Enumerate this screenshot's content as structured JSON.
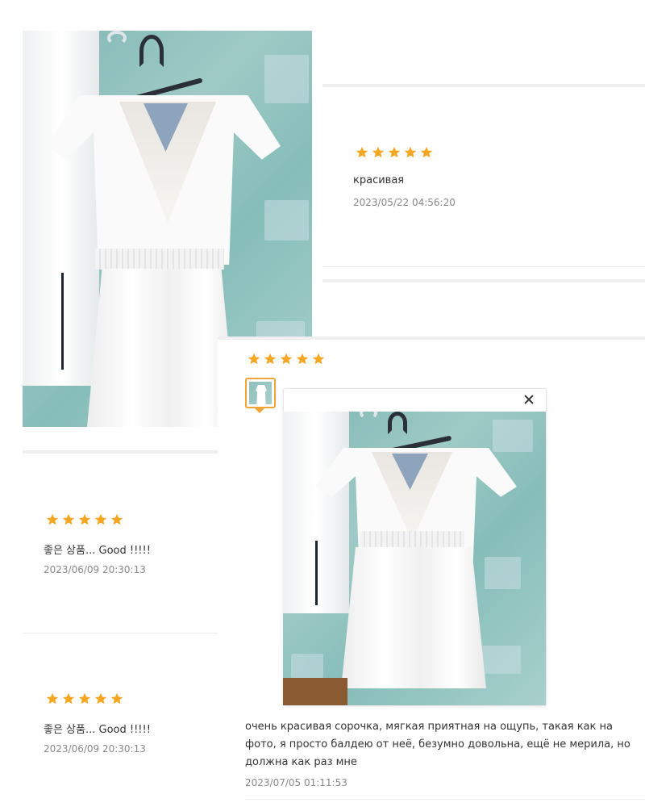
{
  "reviews": [
    {
      "rating": 5,
      "text": "красивая",
      "date": "2023/05/22 04:56:20"
    },
    {
      "rating": 5,
      "text": "좋은 상품... Good !!!!!",
      "date": "2023/06/09 20:30:13"
    },
    {
      "rating": 5,
      "text": "좋은 상품... Good !!!!!",
      "date": "2023/06/09 20:30:13"
    }
  ],
  "expanded_review": {
    "rating": 5,
    "text": "очень красивая сорочка, мягкая приятная на ощупь, такая как на фото, я просто балдею от неё, безумно довольна, ещё не мерила, но должна как раз мне",
    "date": "2023/07/05 01:11:53",
    "photo_count": 1
  },
  "colors": {
    "star": "#f5a623",
    "thumb_border": "#f0a43a",
    "divider": "#efefef",
    "date_text": "#888888"
  },
  "icons": {
    "rating": "star-icon",
    "close": "close-icon"
  }
}
